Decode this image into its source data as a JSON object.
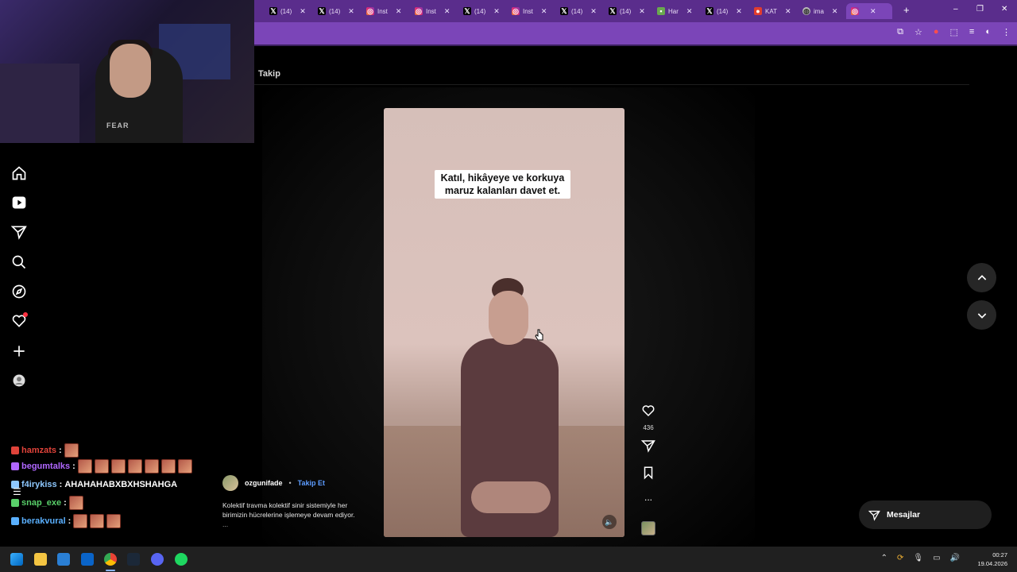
{
  "browser": {
    "tabs": [
      {
        "icon": "x-icon",
        "label": "(14)"
      },
      {
        "icon": "x-icon",
        "label": "(14)"
      },
      {
        "icon": "instagram-icon",
        "label": "Inst"
      },
      {
        "icon": "instagram-icon",
        "label": "Inst"
      },
      {
        "icon": "x-icon",
        "label": "(14)"
      },
      {
        "icon": "instagram-icon",
        "label": "Inst"
      },
      {
        "icon": "x-icon",
        "label": "(14)"
      },
      {
        "icon": "x-icon",
        "label": "(14)"
      },
      {
        "icon": "generic-icon",
        "label": "Har"
      },
      {
        "icon": "x-icon",
        "label": "(14)"
      },
      {
        "icon": "red-icon",
        "label": "KAT"
      },
      {
        "icon": "globe-icon",
        "label": "ima"
      },
      {
        "icon": "instagram-icon",
        "label": ""
      }
    ],
    "new_tab_label": "+",
    "accent": "#7b45b8"
  },
  "webcam": {
    "shirt_text": "FEAR"
  },
  "instagram": {
    "following_label": "Takip",
    "caption_line1": "Katıl, hikâyeye ve korkuya",
    "caption_line2": "maruz kalanları davet et.",
    "like_count": "436",
    "more_label": "...",
    "author_name": "ozgunifade",
    "author_sep": "•",
    "follow_label": "Takip Et",
    "description": "Kolektif travma kolektif sinir sistemiyle her birimizin hücrelerine işlemeye devam ediyor.",
    "description_more": "...",
    "messages_label": "Mesajlar"
  },
  "chat": {
    "lines": [
      {
        "user": "hamzats",
        "color": "#e0433a",
        "text": "",
        "emotes": 1
      },
      {
        "user": "begumtalks",
        "color": "#b067ff",
        "text": "",
        "emotes": 7
      },
      {
        "user": "f4irykiss",
        "color": "#8ec8ff",
        "text": "AHAHAHABXBXHSHAHGA",
        "emotes": 0
      },
      {
        "user": "snap_exe",
        "color": "#59d06a",
        "text": "",
        "emotes": 1
      },
      {
        "user": "berakvural",
        "color": "#5ab0ff",
        "text": "",
        "emotes": 3
      }
    ]
  },
  "taskbar": {
    "time": "00:27",
    "date": "19.04.2026"
  }
}
